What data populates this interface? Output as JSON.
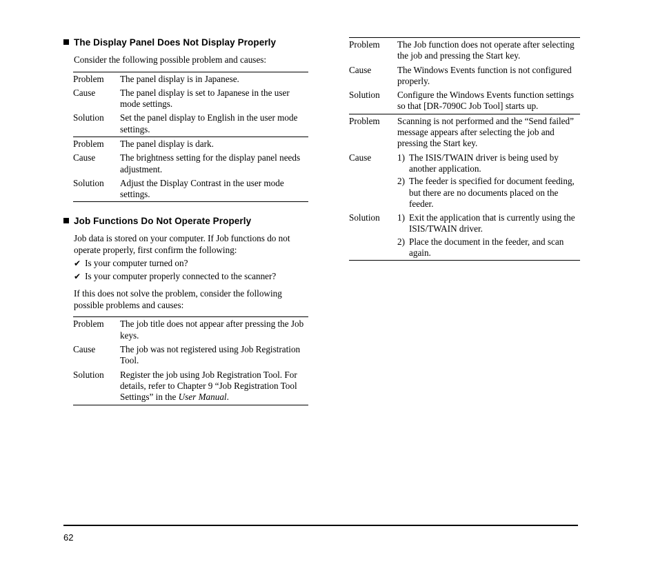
{
  "page": {
    "number": "62"
  },
  "left_column": {
    "section1": {
      "heading": "The Display Panel Does Not Display Properly",
      "intro": "Consider the following possible problem and causes:",
      "entries": [
        {
          "problem_label": "Problem",
          "problem_text": "The panel display is in Japanese.",
          "cause_label": "Cause",
          "cause_text": "The panel display is set to Japanese in the user mode settings.",
          "solution_label": "Solution",
          "solution_text": "Set the panel display to English in the user mode settings."
        },
        {
          "problem_label": "Problem",
          "problem_text": "The panel display is dark.",
          "cause_label": "Cause",
          "cause_text": "The brightness setting for the display panel needs adjustment.",
          "solution_label": "Solution",
          "solution_text": "Adjust the Display Contrast in the user mode settings."
        }
      ]
    },
    "section2": {
      "heading": "Job Functions Do Not Operate Properly",
      "intro": "Job data is stored on your computer. If Job functions do not operate properly, first confirm the following:",
      "checks": [
        "Is your computer turned on?",
        "Is your computer properly connected to the scanner?"
      ],
      "intro2": "If this does not solve the problem, consider the following possible problems and causes:",
      "entries": [
        {
          "problem_label": "Problem",
          "problem_text": "The job title does not appear after pressing the Job keys.",
          "cause_label": "Cause",
          "cause_text": "The job was not registered using Job Registration Tool.",
          "solution_label": "Solution",
          "solution_text_part1": "Register the job using Job Registration Tool. For details, refer to Chapter 9 “Job Registration Tool Settings” in the ",
          "solution_text_italic": "User Manual",
          "solution_text_part2": "."
        }
      ]
    }
  },
  "right_column": {
    "entries": [
      {
        "problem_label": "Problem",
        "problem_text": "The Job function does not operate after selecting the job and pressing the Start key.",
        "cause_label": "Cause",
        "cause_text": "The Windows Events function is not configured properly.",
        "solution_label": "Solution",
        "solution_text": "Configure the Windows Events function settings so that [DR-7090C Job Tool] starts up."
      },
      {
        "problem_label": "Problem",
        "problem_text": "Scanning is not performed and the “Send failed” message appears after selecting the job and pressing the Start key.",
        "cause_label": "Cause",
        "cause_items": [
          {
            "num": "1)",
            "text": "The ISIS/TWAIN driver is being used by another application."
          },
          {
            "num": "2)",
            "text": "The feeder is specified for document feeding, but there are no documents placed on the feeder."
          }
        ],
        "solution_label": "Solution",
        "solution_items": [
          {
            "num": "1)",
            "text": "Exit the application that is currently using the ISIS/TWAIN driver."
          },
          {
            "num": "2)",
            "text": "Place the document in the feeder, and scan again."
          }
        ]
      }
    ]
  },
  "icons": {
    "bullet": "black-square-bullet",
    "check": "✔"
  }
}
